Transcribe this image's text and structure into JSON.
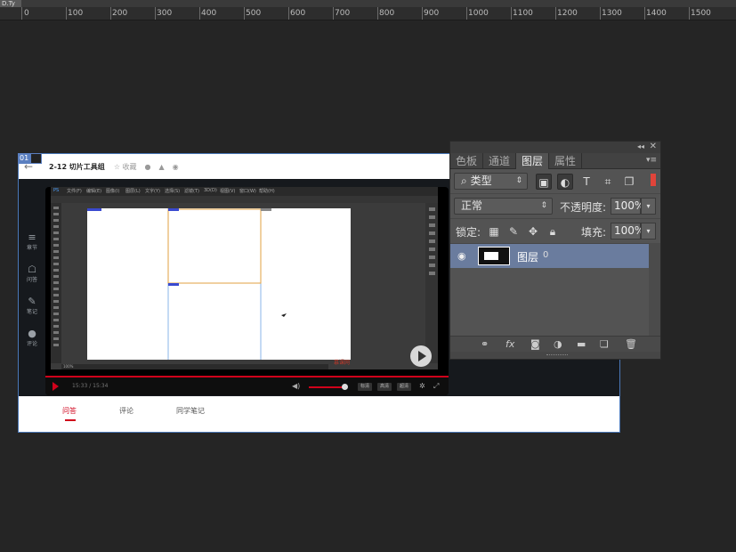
{
  "app": {
    "doc_tab": "D.Ty"
  },
  "ruler": {
    "marks": [
      "0",
      "100",
      "200",
      "300",
      "400",
      "500",
      "600",
      "700",
      "800",
      "900",
      "1000",
      "1100",
      "1200",
      "1300",
      "1400",
      "1500"
    ]
  },
  "artboard": {
    "badge": "01"
  },
  "course_page": {
    "header": {
      "back": "←",
      "title": "2-12 切片工具组",
      "collect": "☆ 收藏"
    },
    "side_nav": [
      {
        "icon": "≡",
        "label": "章节"
      },
      {
        "icon": "☖",
        "label": "问答"
      },
      {
        "icon": "✎",
        "label": "笔记"
      },
      {
        "icon": "●",
        "label": "评论"
      }
    ],
    "player": {
      "current_time": "15:33",
      "total_time": "15:34",
      "time_display": "15:33 / 15:34",
      "volume_percent": 90,
      "progress_percent": 100,
      "quality_options": [
        "标清",
        "高清",
        "超清"
      ]
    },
    "ps_screen": {
      "menu": [
        "PS",
        "文件(F)",
        "编辑(E)",
        "图像(I)",
        "图层(L)",
        "文字(Y)",
        "选择(S)",
        "滤镜(T)",
        "3D(D)",
        "视图(V)",
        "窗口(W)",
        "帮助(H)"
      ],
      "zoom": "100%",
      "watermark": "慕课网"
    },
    "bottom_tabs": [
      {
        "label": "问答",
        "active": true
      },
      {
        "label": "评论",
        "active": false
      },
      {
        "label": "同学笔记",
        "active": false
      }
    ]
  },
  "layers_panel": {
    "topbar": {
      "collapse": "◂◂",
      "close": "✕"
    },
    "tabs": [
      "色板",
      "通道",
      "图层",
      "属性"
    ],
    "active_tab": "图层",
    "menu_icon": "▾≡",
    "filter": {
      "value": "类型",
      "search_glyph": "⌕"
    },
    "filter_icons": {
      "type": "T"
    },
    "blend_mode": "正常",
    "opacity": {
      "label": "不透明度:",
      "value": "100%"
    },
    "lock": {
      "label": "锁定:"
    },
    "fill": {
      "label": "填充:",
      "value": "100%"
    },
    "layers": [
      {
        "name": "图层",
        "suffix": "0",
        "visible": true,
        "selected": true
      }
    ],
    "footer_icons": [
      "link-icon",
      "fx-icon",
      "mask-icon",
      "adjustment-icon",
      "folder-icon",
      "new-layer-icon",
      "trash-icon"
    ],
    "footer_fx": "fx"
  },
  "colors": {
    "accent": "#d0021b",
    "selection": "#6a7c9e",
    "panel_bg": "#535353",
    "workspace": "#252525"
  }
}
